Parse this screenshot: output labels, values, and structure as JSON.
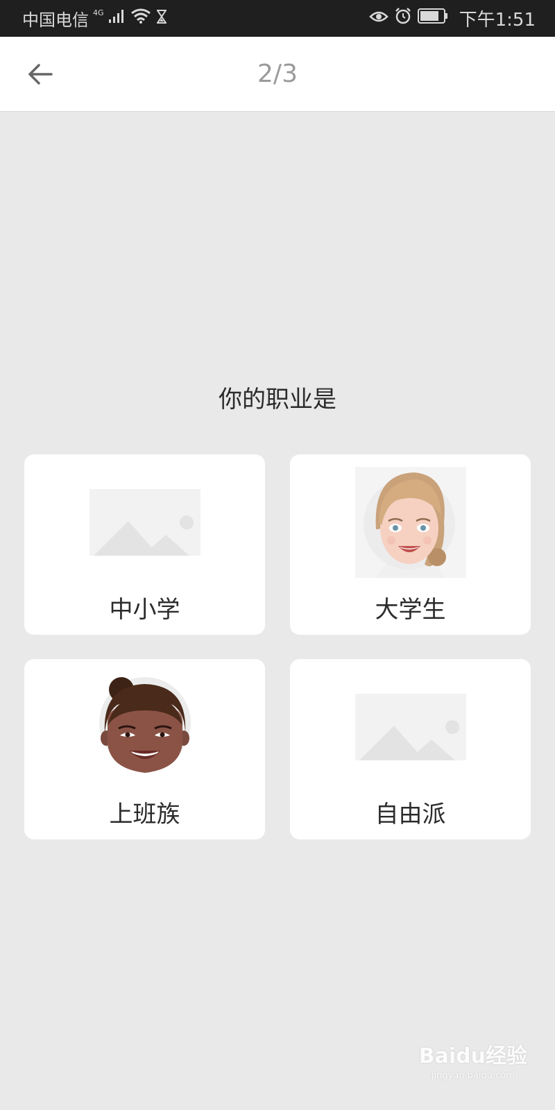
{
  "status_bar": {
    "carrier": "中国电信",
    "network_type": "4G",
    "time": "下午1:51"
  },
  "header": {
    "page_indicator": "2/3"
  },
  "question": "你的职业是",
  "options": [
    {
      "label": "中小学",
      "image": "image-placeholder"
    },
    {
      "label": "大学生",
      "image": "female-avatar-blonde"
    },
    {
      "label": "上班族",
      "image": "female-avatar-bun"
    },
    {
      "label": "自由派",
      "image": "image-placeholder"
    }
  ],
  "watermark": {
    "main": "Baidu经验",
    "sub": "jingyan.baidu.com"
  },
  "colors": {
    "background": "#e9e9e9",
    "card": "#ffffff",
    "status_bar": "#1f1f1f",
    "page_indicator": "#9a9a9a"
  }
}
